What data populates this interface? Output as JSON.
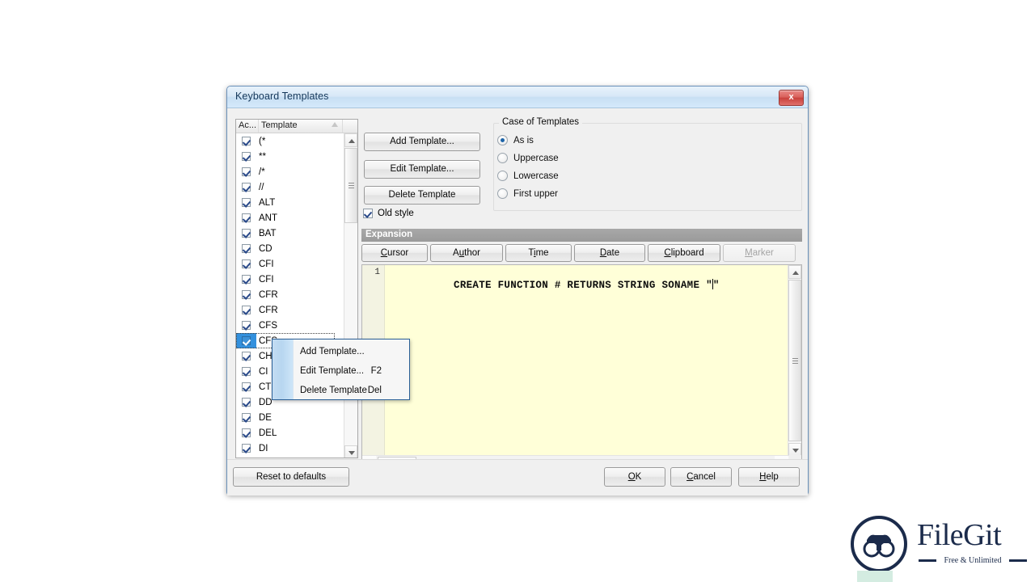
{
  "window": {
    "title": "Keyboard Templates",
    "close_label": "x"
  },
  "list": {
    "columns": [
      "Ac...",
      "Template"
    ],
    "sort_indicator": "ascending",
    "rows": [
      {
        "label": "(*",
        "checked": true,
        "selected": false
      },
      {
        "label": "**",
        "checked": true,
        "selected": false
      },
      {
        "label": "/*",
        "checked": true,
        "selected": false
      },
      {
        "label": "//",
        "checked": true,
        "selected": false
      },
      {
        "label": "ALT",
        "checked": true,
        "selected": false
      },
      {
        "label": "ANT",
        "checked": true,
        "selected": false
      },
      {
        "label": "BAT",
        "checked": true,
        "selected": false
      },
      {
        "label": "CD",
        "checked": true,
        "selected": false
      },
      {
        "label": "CFI",
        "checked": true,
        "selected": false
      },
      {
        "label": "CFI",
        "checked": true,
        "selected": false
      },
      {
        "label": "CFR",
        "checked": true,
        "selected": false
      },
      {
        "label": "CFR",
        "checked": true,
        "selected": false
      },
      {
        "label": "CFS",
        "checked": true,
        "selected": false
      },
      {
        "label": "CFS",
        "checked": true,
        "selected": true
      },
      {
        "label": "CH",
        "checked": true,
        "selected": false
      },
      {
        "label": "CI",
        "checked": true,
        "selected": false
      },
      {
        "label": "CT",
        "checked": true,
        "selected": false
      },
      {
        "label": "DD",
        "checked": true,
        "selected": false
      },
      {
        "label": "DE",
        "checked": true,
        "selected": false
      },
      {
        "label": "DEL",
        "checked": true,
        "selected": false
      },
      {
        "label": "DI",
        "checked": true,
        "selected": false
      }
    ]
  },
  "commands": {
    "add": "Add Template...",
    "edit": "Edit Template...",
    "delete": "Delete Template",
    "old_style": "Old style",
    "old_style_checked": true
  },
  "case_group": {
    "legend": "Case of Templates",
    "options": [
      {
        "label": "As is",
        "selected": true
      },
      {
        "label": "Uppercase",
        "selected": false
      },
      {
        "label": "Lowercase",
        "selected": false
      },
      {
        "label": "First upper",
        "selected": false
      }
    ]
  },
  "expansion": {
    "header": "Expansion",
    "toolbar": [
      {
        "label": "Cursor",
        "accel": "C",
        "disabled": false
      },
      {
        "label": "Author",
        "accel": "u",
        "disabled": false
      },
      {
        "label": "Time",
        "accel": "i",
        "disabled": false
      },
      {
        "label": "Date",
        "accel": "D",
        "disabled": false
      },
      {
        "label": "Clipboard",
        "accel": "C",
        "disabled": false
      },
      {
        "label": "Marker",
        "accel": "M",
        "disabled": true
      }
    ],
    "editor": {
      "line_number": "1",
      "code_before_caret": "CREATE FUNCTION # RETURNS STRING SONAME \"",
      "code_after_caret": "\""
    }
  },
  "context_menu": {
    "items": [
      {
        "label": "Add Template...",
        "shortcut": ""
      },
      {
        "label": "Edit Template...",
        "shortcut": "F2"
      },
      {
        "label": "Delete Template",
        "shortcut": "Del"
      }
    ]
  },
  "footer": {
    "reset": "Reset to defaults",
    "ok": "OK",
    "ok_accel": "O",
    "cancel": "Cancel",
    "cancel_accel": "C",
    "help": "Help",
    "help_accel": "H"
  },
  "watermark": {
    "name": "FileGit",
    "tagline": "Free & Unlimited"
  },
  "colors": {
    "selection": "#3390dd",
    "title_text": "#14375a",
    "close_button": "#c9423d",
    "editor_background": "#ffffd8",
    "menu_border": "#2a5f96",
    "brand": "#1b2b4b"
  }
}
